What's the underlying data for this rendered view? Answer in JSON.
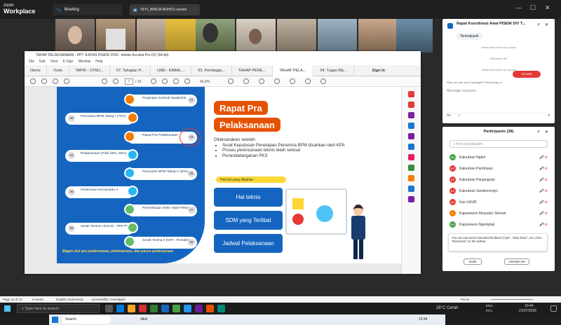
{
  "zoom": {
    "logo_top": "zoom",
    "logo_bottom": "Workplace",
    "meeting_tab": "Meeting",
    "share_tab": "Tit Pi_NRK2A ROHO's screen"
  },
  "acrobat": {
    "title": "TAHAP PELAKSANAAN - PPT JUKNIS PISEW 2025 - Adobe Acrobat Pro DC (64-bit)",
    "menu": [
      "File",
      "Edit",
      "View",
      "E-Sign",
      "Window",
      "Help"
    ],
    "tabs": [
      "Home",
      "Tools",
      "TAPRI - STRU...",
      "07. Tahapan P...",
      "UND - KABAL...",
      "03. Pembagia...",
      "TAHAP PERE...",
      "TAHAP PELA...",
      "04. Tugas Ma..."
    ],
    "sign_in": "Sign In",
    "page_current": "7",
    "page_total": "/ 10",
    "zoom_level": "49,9%",
    "steps": [
      {
        "n": "01",
        "label": "Perjanjian Kontrak Swakelola"
      },
      {
        "n": "02",
        "label": "Pencairan BPM Tahap I (70%)"
      },
      {
        "n": "03",
        "label": "Rapat Pra Pelaksanaan"
      },
      {
        "n": "04",
        "label": "Pelaksanaan (Fisik 25%, 50%)"
      },
      {
        "n": "05",
        "label": "Pencairan BPM Tahap II (30%)"
      },
      {
        "n": "06",
        "label": "Pertemuan Kecamatan II"
      },
      {
        "n": "07",
        "label": "Pemeriksaan Akhir Hasil Pekerjaan"
      },
      {
        "n": "08",
        "label": "Serah Terima I (KKAD - PPK PKS)"
      },
      {
        "n": "09",
        "label": "Serah Terima II (KPA - Pemdes)"
      }
    ],
    "ribbon": "Bagan alur pra pelaksanaan, pelaksanaan, dan pasca pelaksanaan",
    "slide_title_1": "Rapat Pra",
    "slide_title_2": "Pelaksanaan",
    "intro": "Dilaksanakan setelah",
    "bullets": [
      "Surat Keputusan Penetapan Penerima BPM disahkan oleh KPA",
      "Proses perencanaan teknis telah selesai",
      "Penandatanganan PKS"
    ],
    "hal_label": "Hal-hal yang dibahas :",
    "pills": [
      "Hal teknis",
      "SDM yang Terlibat",
      "Jadwal Pelaksanaan"
    ],
    "taskbar_search": "Search",
    "taskbar_weather": "dikol",
    "taskbar_time": "10:44"
  },
  "chat": {
    "title": "Rapat Koordinasi Awal PISEW DIY T...",
    "msg": "Terimakasih",
    "sys1": "Srikandiwi joined as a guest",
    "sys2": "Srikandiwi left",
    "sys3": "Srikandiwi joined as a guest",
    "new_btn": "10 new",
    "to_label": "Who can see your messages? Recording on",
    "placeholder": "Message everyone"
  },
  "participants": {
    "title": "Participants (38)",
    "search_placeholder": "Find a participant",
    "rows": [
      {
        "av": "KN",
        "name": "Kalurahan Ngleri",
        "color": "#43a047"
      },
      {
        "av": "KP",
        "name": "Kalurahan Pandowan",
        "color": "#e53935"
      },
      {
        "av": "KP",
        "name": "Kalurahan Panjangrejo",
        "color": "#e53935"
      },
      {
        "av": "KS",
        "name": "Kalurahan Sumbermulyo",
        "color": "#e53935"
      },
      {
        "av": "KG",
        "name": "Kep GAUR",
        "color": "#e53935"
      },
      {
        "av": "K",
        "name": "Kapanewon Moyudan Sleman",
        "color": "#f57c00"
      },
      {
        "av": "KN",
        "name": "Kapanewon Ngemplak",
        "color": "#43a047"
      }
    ],
    "tip": "You can now send nonverbal feedback (\"yes\", \"slow down\", etc.) from \"Reactions\" on the toolbar.",
    "invite_btn": "Invite",
    "unmute_btn": "Unmute me"
  },
  "word_status": {
    "page": "Page 11 of 12",
    "words": "0 words",
    "lang": "English (Indonesia)",
    "acc": "Accessibility: Investigate",
    "focus": "Focus"
  },
  "taskbar": {
    "search": "Type here to search",
    "weather": "28°C Cerah",
    "lang": "ENG",
    "intl": "INTL",
    "time": "10:44",
    "date": "21/07/2025"
  }
}
